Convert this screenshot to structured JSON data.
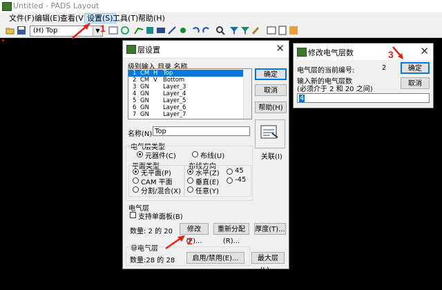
{
  "app": {
    "title": "Untitled - PADS Layout",
    "menu": [
      "文件(F)",
      "编辑(E)",
      "查看(V)",
      "设置(S)",
      "工具(T)",
      "帮助(H)"
    ],
    "layer_select": "(H) Top",
    "toolbar_icons": [
      "new-icon",
      "save-icon",
      "undo-icon",
      "redo-icon",
      "route-icon",
      "drc-icon",
      "cam-icon",
      "zoom-icon",
      "fit-icon",
      "help-icon"
    ]
  },
  "layer_dialog": {
    "title": "层设置",
    "list_header": "级别输入 目录  名称",
    "layers": [
      {
        "num": "1",
        "dir": "CM",
        "orient": "H",
        "name": "Top",
        "selected": true
      },
      {
        "num": "2",
        "dir": "CM",
        "orient": "V",
        "name": "Bottom",
        "selected": false
      },
      {
        "num": "3",
        "dir": "GN",
        "orient": "",
        "name": "Layer_3",
        "selected": false
      },
      {
        "num": "4",
        "dir": "GN",
        "orient": "",
        "name": "Layer_4",
        "selected": false
      },
      {
        "num": "5",
        "dir": "GN",
        "orient": "",
        "name": "Layer_5",
        "selected": false
      },
      {
        "num": "6",
        "dir": "GN",
        "orient": "",
        "name": "Layer_6",
        "selected": false
      },
      {
        "num": "7",
        "dir": "GN",
        "orient": "",
        "name": "Layer_7",
        "selected": false
      }
    ],
    "ok_label": "确定",
    "cancel_label": "取消",
    "help_label": "帮助(H)",
    "name_label": "名称(N):",
    "name_value": "Top",
    "elec_type_title": "电气层类型",
    "component_label": "元器件(C)",
    "routing_label": "布线(U)",
    "associate_label": "关联(I)",
    "plane_type_title": "平面类型",
    "plane_none": "无平面(P)",
    "plane_cam": "CAM 平面",
    "plane_split": "分割/混合(X)",
    "route_dir_title": "布线方向",
    "dir_horizontal": "水平(Z)",
    "dir_vertical": "垂直(E)",
    "dir_any": "任意(Y)",
    "dir_45": "45",
    "dir_m45": "-45",
    "elec_layer_title": "电气层",
    "single_sided_label": "支持单面板(B)",
    "count_label": "数量: 2 的 20",
    "modify_label": "修改(F)...",
    "renumber_label": "重新分配(R)...",
    "thickness_label": "厚度(T)...",
    "nonelec_title": "非电气层",
    "nonelec_count": "数量:28 的 28",
    "enable_label": "启用/禁用(E)...",
    "max_layer_label": "最大层(L)..."
  },
  "modify_dialog": {
    "title": "修改电气层数",
    "current_label": "电气层的当前编号:",
    "current_value": "2",
    "ok_label": "确定",
    "prompt1": "输入新的电气层数",
    "prompt2": "(必须介于 2 和 20 之间)",
    "cancel_label": "取消",
    "input_value": "4"
  },
  "annotations": {
    "step1": "1",
    "step2": "2",
    "step3": "3"
  }
}
